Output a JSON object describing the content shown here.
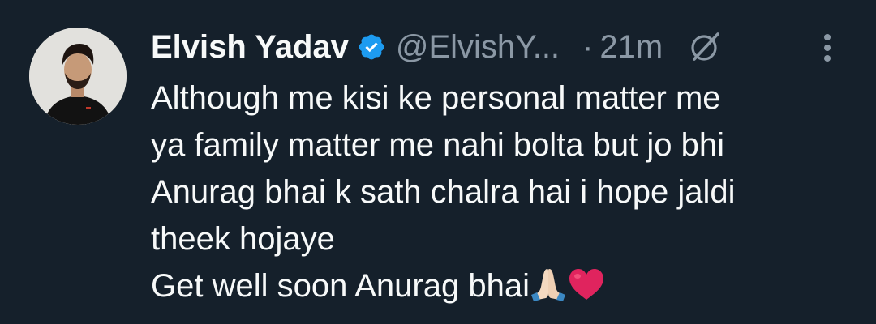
{
  "tweet": {
    "author_name": "Elvish Yadav",
    "handle": "@ElvishY...",
    "separator": "·",
    "time": "21m",
    "verified": true,
    "lines": [
      "Although me kisi ke personal matter me",
      "ya family matter me nahi bolta but jo bhi",
      "Anurag bhai k sath chalra hai i hope jaldi",
      "theek hojaye",
      "Get well soon Anurag bhai"
    ],
    "emojis": [
      "folded-hands",
      "red-heart"
    ]
  },
  "colors": {
    "background": "#15202b",
    "text": "#f7f9f9",
    "muted": "#8b98a5",
    "verified": "#1d9bf0",
    "heart": "#e0245e"
  }
}
